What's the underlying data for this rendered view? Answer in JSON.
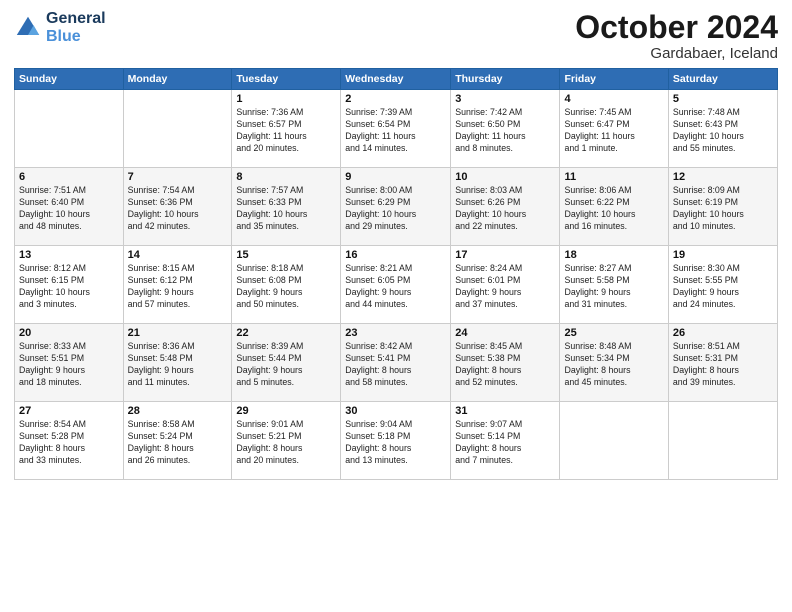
{
  "logo": {
    "line1": "General",
    "line2": "Blue"
  },
  "header": {
    "month": "October 2024",
    "location": "Gardabaer, Iceland"
  },
  "weekdays": [
    "Sunday",
    "Monday",
    "Tuesday",
    "Wednesday",
    "Thursday",
    "Friday",
    "Saturday"
  ],
  "weeks": [
    [
      {
        "day": "",
        "info": ""
      },
      {
        "day": "",
        "info": ""
      },
      {
        "day": "1",
        "info": "Sunrise: 7:36 AM\nSunset: 6:57 PM\nDaylight: 11 hours\nand 20 minutes."
      },
      {
        "day": "2",
        "info": "Sunrise: 7:39 AM\nSunset: 6:54 PM\nDaylight: 11 hours\nand 14 minutes."
      },
      {
        "day": "3",
        "info": "Sunrise: 7:42 AM\nSunset: 6:50 PM\nDaylight: 11 hours\nand 8 minutes."
      },
      {
        "day": "4",
        "info": "Sunrise: 7:45 AM\nSunset: 6:47 PM\nDaylight: 11 hours\nand 1 minute."
      },
      {
        "day": "5",
        "info": "Sunrise: 7:48 AM\nSunset: 6:43 PM\nDaylight: 10 hours\nand 55 minutes."
      }
    ],
    [
      {
        "day": "6",
        "info": "Sunrise: 7:51 AM\nSunset: 6:40 PM\nDaylight: 10 hours\nand 48 minutes."
      },
      {
        "day": "7",
        "info": "Sunrise: 7:54 AM\nSunset: 6:36 PM\nDaylight: 10 hours\nand 42 minutes."
      },
      {
        "day": "8",
        "info": "Sunrise: 7:57 AM\nSunset: 6:33 PM\nDaylight: 10 hours\nand 35 minutes."
      },
      {
        "day": "9",
        "info": "Sunrise: 8:00 AM\nSunset: 6:29 PM\nDaylight: 10 hours\nand 29 minutes."
      },
      {
        "day": "10",
        "info": "Sunrise: 8:03 AM\nSunset: 6:26 PM\nDaylight: 10 hours\nand 22 minutes."
      },
      {
        "day": "11",
        "info": "Sunrise: 8:06 AM\nSunset: 6:22 PM\nDaylight: 10 hours\nand 16 minutes."
      },
      {
        "day": "12",
        "info": "Sunrise: 8:09 AM\nSunset: 6:19 PM\nDaylight: 10 hours\nand 10 minutes."
      }
    ],
    [
      {
        "day": "13",
        "info": "Sunrise: 8:12 AM\nSunset: 6:15 PM\nDaylight: 10 hours\nand 3 minutes."
      },
      {
        "day": "14",
        "info": "Sunrise: 8:15 AM\nSunset: 6:12 PM\nDaylight: 9 hours\nand 57 minutes."
      },
      {
        "day": "15",
        "info": "Sunrise: 8:18 AM\nSunset: 6:08 PM\nDaylight: 9 hours\nand 50 minutes."
      },
      {
        "day": "16",
        "info": "Sunrise: 8:21 AM\nSunset: 6:05 PM\nDaylight: 9 hours\nand 44 minutes."
      },
      {
        "day": "17",
        "info": "Sunrise: 8:24 AM\nSunset: 6:01 PM\nDaylight: 9 hours\nand 37 minutes."
      },
      {
        "day": "18",
        "info": "Sunrise: 8:27 AM\nSunset: 5:58 PM\nDaylight: 9 hours\nand 31 minutes."
      },
      {
        "day": "19",
        "info": "Sunrise: 8:30 AM\nSunset: 5:55 PM\nDaylight: 9 hours\nand 24 minutes."
      }
    ],
    [
      {
        "day": "20",
        "info": "Sunrise: 8:33 AM\nSunset: 5:51 PM\nDaylight: 9 hours\nand 18 minutes."
      },
      {
        "day": "21",
        "info": "Sunrise: 8:36 AM\nSunset: 5:48 PM\nDaylight: 9 hours\nand 11 minutes."
      },
      {
        "day": "22",
        "info": "Sunrise: 8:39 AM\nSunset: 5:44 PM\nDaylight: 9 hours\nand 5 minutes."
      },
      {
        "day": "23",
        "info": "Sunrise: 8:42 AM\nSunset: 5:41 PM\nDaylight: 8 hours\nand 58 minutes."
      },
      {
        "day": "24",
        "info": "Sunrise: 8:45 AM\nSunset: 5:38 PM\nDaylight: 8 hours\nand 52 minutes."
      },
      {
        "day": "25",
        "info": "Sunrise: 8:48 AM\nSunset: 5:34 PM\nDaylight: 8 hours\nand 45 minutes."
      },
      {
        "day": "26",
        "info": "Sunrise: 8:51 AM\nSunset: 5:31 PM\nDaylight: 8 hours\nand 39 minutes."
      }
    ],
    [
      {
        "day": "27",
        "info": "Sunrise: 8:54 AM\nSunset: 5:28 PM\nDaylight: 8 hours\nand 33 minutes."
      },
      {
        "day": "28",
        "info": "Sunrise: 8:58 AM\nSunset: 5:24 PM\nDaylight: 8 hours\nand 26 minutes."
      },
      {
        "day": "29",
        "info": "Sunrise: 9:01 AM\nSunset: 5:21 PM\nDaylight: 8 hours\nand 20 minutes."
      },
      {
        "day": "30",
        "info": "Sunrise: 9:04 AM\nSunset: 5:18 PM\nDaylight: 8 hours\nand 13 minutes."
      },
      {
        "day": "31",
        "info": "Sunrise: 9:07 AM\nSunset: 5:14 PM\nDaylight: 8 hours\nand 7 minutes."
      },
      {
        "day": "",
        "info": ""
      },
      {
        "day": "",
        "info": ""
      }
    ]
  ]
}
